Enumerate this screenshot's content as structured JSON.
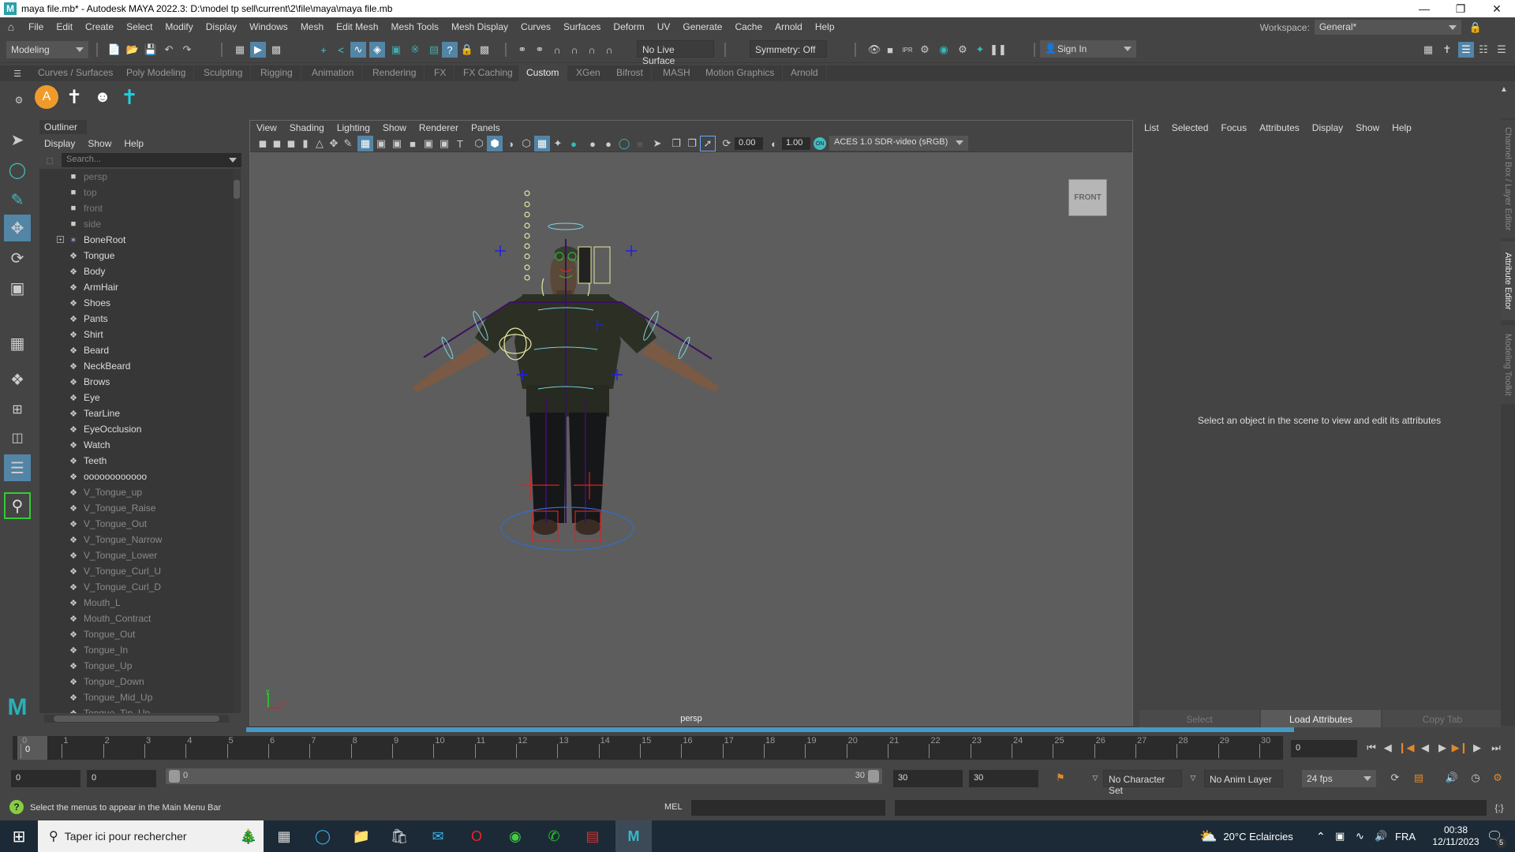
{
  "window": {
    "title": "maya file.mb* - Autodesk MAYA 2022.3: D:\\model tp sell\\current\\2\\file\\maya\\maya file.mb",
    "controls": [
      "minimize",
      "restore",
      "close"
    ]
  },
  "menubar": {
    "items": [
      "File",
      "Edit",
      "Create",
      "Select",
      "Modify",
      "Display",
      "Windows",
      "Mesh",
      "Edit Mesh",
      "Mesh Tools",
      "Mesh Display",
      "Curves",
      "Surfaces",
      "Deform",
      "UV",
      "Generate",
      "Cache",
      "Arnold",
      "Help"
    ],
    "workspace_label": "Workspace:",
    "workspace_value": "General*"
  },
  "statusline": {
    "menuset": "Modeling",
    "live_surface": "No Live Surface",
    "symmetry": "Symmetry: Off",
    "sign_in": "Sign In"
  },
  "shelf": {
    "tabs": [
      "Curves / Surfaces",
      "Poly Modeling",
      "Sculpting",
      "Rigging",
      "Animation",
      "Rendering",
      "FX",
      "FX Caching",
      "Custom",
      "XGen",
      "Bifrost",
      "MASH",
      "Motion Graphics",
      "Arnold"
    ],
    "active_tab": "Custom",
    "icons": [
      "advanced-skeleton-icon",
      "biped-skeleton-icon",
      "face-rig-icon",
      "cyan-skeleton-icon"
    ]
  },
  "outliner": {
    "title": "Outliner",
    "menu": [
      "Display",
      "Show",
      "Help"
    ],
    "search_placeholder": "Search...",
    "items": [
      {
        "label": "persp",
        "type": "camera",
        "dim": true
      },
      {
        "label": "top",
        "type": "camera",
        "dim": true
      },
      {
        "label": "front",
        "type": "camera",
        "dim": true
      },
      {
        "label": "side",
        "type": "camera",
        "dim": true
      },
      {
        "label": "BoneRoot",
        "type": "joint",
        "dim": false,
        "expandable": true
      },
      {
        "label": "Tongue",
        "type": "mesh",
        "dim": false
      },
      {
        "label": "Body",
        "type": "mesh",
        "dim": false
      },
      {
        "label": "ArmHair",
        "type": "mesh",
        "dim": false
      },
      {
        "label": "Shoes",
        "type": "mesh",
        "dim": false
      },
      {
        "label": "Pants",
        "type": "mesh",
        "dim": false
      },
      {
        "label": "Shirt",
        "type": "mesh",
        "dim": false
      },
      {
        "label": "Beard",
        "type": "mesh",
        "dim": false
      },
      {
        "label": "NeckBeard",
        "type": "mesh",
        "dim": false
      },
      {
        "label": "Brows",
        "type": "mesh",
        "dim": false
      },
      {
        "label": "Eye",
        "type": "mesh",
        "dim": false
      },
      {
        "label": "TearLine",
        "type": "mesh",
        "dim": false
      },
      {
        "label": "EyeOcclusion",
        "type": "mesh",
        "dim": false
      },
      {
        "label": "Watch",
        "type": "mesh",
        "dim": false
      },
      {
        "label": "Teeth",
        "type": "mesh",
        "dim": false
      },
      {
        "label": "oooooooooooo",
        "type": "mesh",
        "dim": false
      },
      {
        "label": "V_Tongue_up",
        "type": "mesh",
        "dim": true
      },
      {
        "label": "V_Tongue_Raise",
        "type": "mesh",
        "dim": true
      },
      {
        "label": "V_Tongue_Out",
        "type": "mesh",
        "dim": true
      },
      {
        "label": "V_Tongue_Narrow",
        "type": "mesh",
        "dim": true
      },
      {
        "label": "V_Tongue_Lower",
        "type": "mesh",
        "dim": true
      },
      {
        "label": "V_Tongue_Curl_U",
        "type": "mesh",
        "dim": true
      },
      {
        "label": "V_Tongue_Curl_D",
        "type": "mesh",
        "dim": true
      },
      {
        "label": "Mouth_L",
        "type": "mesh",
        "dim": true
      },
      {
        "label": "Mouth_Contract",
        "type": "mesh",
        "dim": true
      },
      {
        "label": "Tongue_Out",
        "type": "mesh",
        "dim": true
      },
      {
        "label": "Tongue_In",
        "type": "mesh",
        "dim": true
      },
      {
        "label": "Tongue_Up",
        "type": "mesh",
        "dim": true
      },
      {
        "label": "Tongue_Down",
        "type": "mesh",
        "dim": true
      },
      {
        "label": "Tongue_Mid_Up",
        "type": "mesh",
        "dim": true
      },
      {
        "label": "Tongue_Tip_Up",
        "type": "mesh",
        "dim": true
      }
    ]
  },
  "viewport": {
    "menu": [
      "View",
      "Shading",
      "Lighting",
      "Show",
      "Renderer",
      "Panels"
    ],
    "exposure": "0.00",
    "gamma": "1.00",
    "color_management": "ACES 1.0 SDR-video (sRGB)",
    "view_cube_label": "FRONT",
    "camera_label": "persp",
    "axis_labels": {
      "x": "x",
      "y": "y",
      "z": "z"
    }
  },
  "attribute_editor": {
    "menu": [
      "List",
      "Selected",
      "Focus",
      "Attributes",
      "Display",
      "Show",
      "Help"
    ],
    "message": "Select an object in the scene to view and edit its attributes",
    "buttons": {
      "select": "Select",
      "load": "Load Attributes",
      "copy": "Copy Tab"
    },
    "side_tabs": [
      "Channel Box / Layer Editor",
      "Attribute Editor",
      "Modeling Toolkit"
    ],
    "active_side_tab": "Attribute Editor"
  },
  "timeslider": {
    "ticks": [
      "0",
      "1",
      "2",
      "3",
      "4",
      "5",
      "6",
      "7",
      "8",
      "9",
      "10",
      "11",
      "12",
      "13",
      "14",
      "15",
      "16",
      "17",
      "18",
      "19",
      "20",
      "21",
      "22",
      "23",
      "24",
      "25",
      "26",
      "27",
      "28",
      "29",
      "30"
    ],
    "current_frame_marker": "0",
    "current_frame_field": "0"
  },
  "rangeslider": {
    "start_field": "0",
    "anim_start_field": "0",
    "range_start": "0",
    "range_end": "30",
    "end_field": "30",
    "anim_end_field": "30",
    "character_set": "No Character Set",
    "anim_layer": "No Anim Layer",
    "fps": "24 fps"
  },
  "commandline": {
    "help_text": "Select the menus to appear in the Main Menu Bar",
    "language": "MEL"
  },
  "taskbar": {
    "search_placeholder": "Taper ici pour rechercher",
    "apps": [
      "task-view",
      "edge",
      "file-explorer",
      "microsoft-store",
      "mail",
      "opera",
      "chrome",
      "whatsapp",
      "winrar",
      "maya"
    ],
    "weather": "20°C  Eclaircies",
    "language": "FRA",
    "time": "00:38",
    "date": "12/11/2023",
    "notifications": "5"
  }
}
